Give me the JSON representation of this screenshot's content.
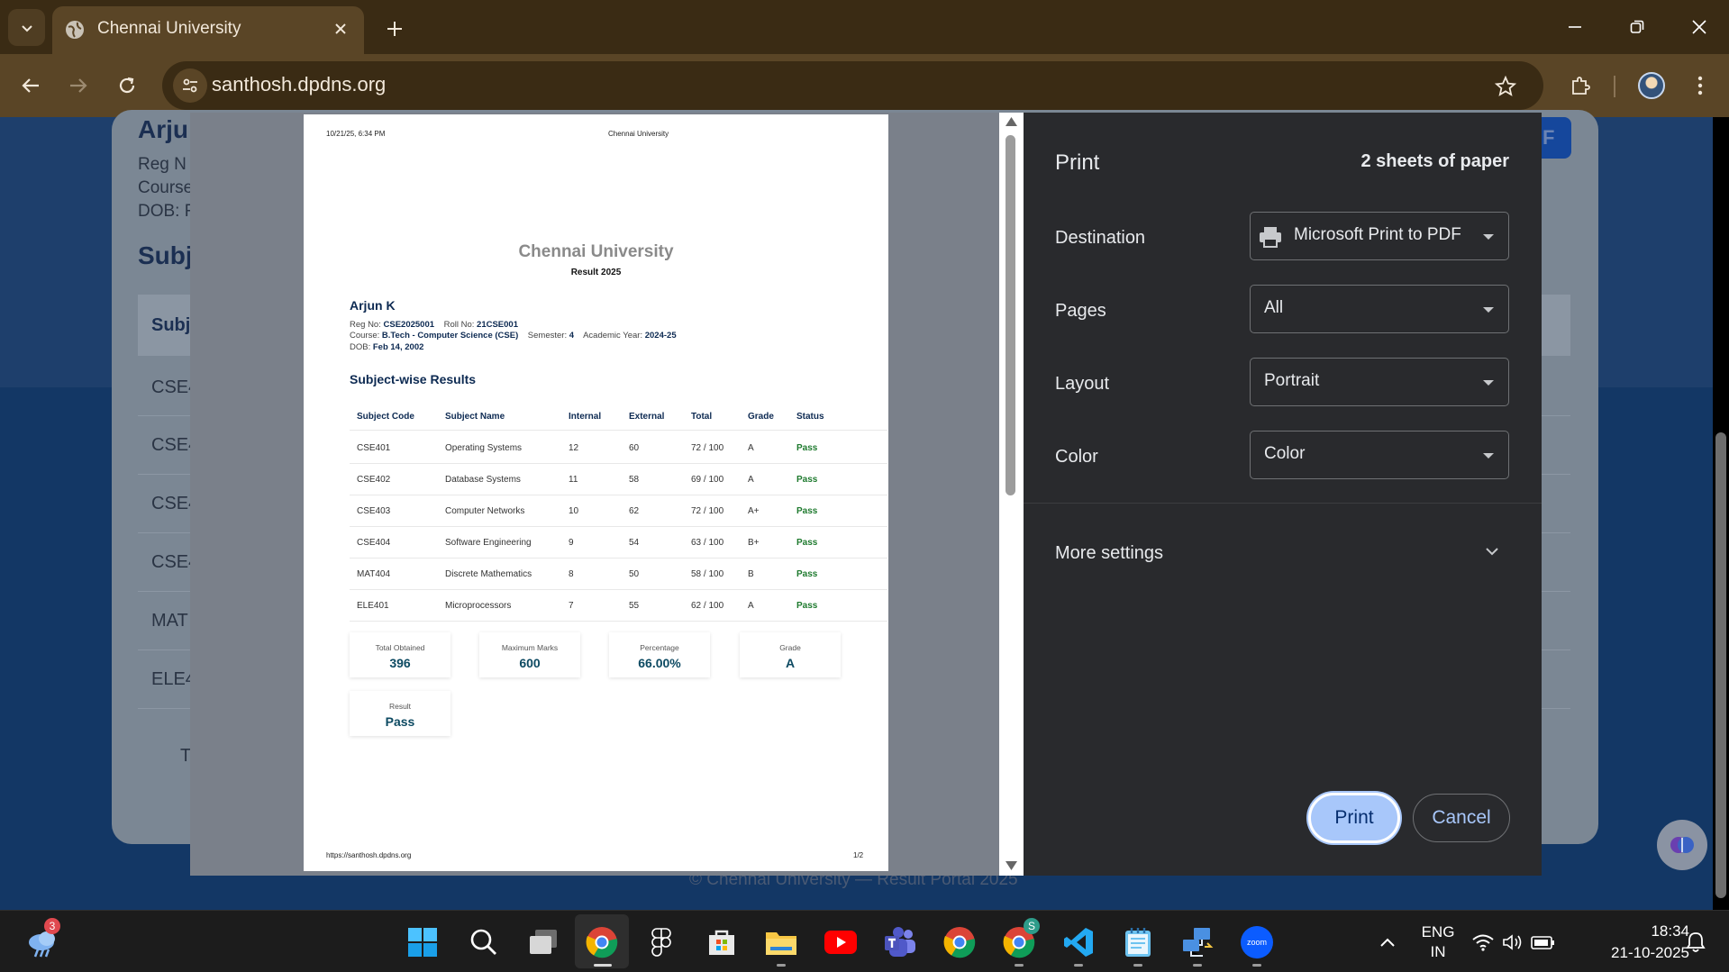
{
  "browser": {
    "tab_title": "Chennai University",
    "url": "santhosh.dpdns.org"
  },
  "background_page": {
    "student_name_partial": "Arju",
    "reg_partial": "Reg N",
    "course_partial": "Course",
    "dob_partial": "DOB: F",
    "section_partial": "Subj",
    "table_header_partial": "Subj",
    "rows_partial": [
      "CSE4",
      "CSE4",
      "CSE4",
      "CSE4",
      "MAT",
      "ELE4"
    ],
    "summary_partial": "T",
    "button_partial": "F",
    "footer": "© Chennai University — Result Portal 2025"
  },
  "preview": {
    "header_datetime": "10/21/25, 6:34 PM",
    "header_title": "Chennai University",
    "university": "Chennai University",
    "result_title": "Result 2025",
    "student_name": "Arjun K",
    "reg_label": "Reg No:",
    "reg_no": "CSE2025001",
    "roll_label": "Roll No:",
    "roll_no": "21CSE001",
    "course_label": "Course:",
    "course": "B.Tech - Computer Science (CSE)",
    "semester_label": "Semester:",
    "semester": "4",
    "year_label": "Academic Year:",
    "academic_year": "2024-25",
    "dob_label": "DOB:",
    "dob": "Feb 14, 2002",
    "section_title": "Subject-wise Results",
    "columns": [
      "Subject Code",
      "Subject Name",
      "Internal",
      "External",
      "Total",
      "Grade",
      "Status"
    ],
    "rows": [
      {
        "code": "CSE401",
        "name": "Operating Systems",
        "internal": "12",
        "external": "60",
        "total": "72 / 100",
        "grade": "A",
        "status": "Pass"
      },
      {
        "code": "CSE402",
        "name": "Database Systems",
        "internal": "11",
        "external": "58",
        "total": "69 / 100",
        "grade": "A",
        "status": "Pass"
      },
      {
        "code": "CSE403",
        "name": "Computer Networks",
        "internal": "10",
        "external": "62",
        "total": "72 / 100",
        "grade": "A+",
        "status": "Pass"
      },
      {
        "code": "CSE404",
        "name": "Software Engineering",
        "internal": "9",
        "external": "54",
        "total": "63 / 100",
        "grade": "B+",
        "status": "Pass"
      },
      {
        "code": "MAT404",
        "name": "Discrete Mathematics",
        "internal": "8",
        "external": "50",
        "total": "58 / 100",
        "grade": "B",
        "status": "Pass"
      },
      {
        "code": "ELE401",
        "name": "Microprocessors",
        "internal": "7",
        "external": "55",
        "total": "62 / 100",
        "grade": "A",
        "status": "Pass"
      }
    ],
    "summary": [
      {
        "label": "Total Obtained",
        "value": "396"
      },
      {
        "label": "Maximum Marks",
        "value": "600"
      },
      {
        "label": "Percentage",
        "value": "66.00%"
      },
      {
        "label": "Grade",
        "value": "A"
      },
      {
        "label": "Result",
        "value": "Pass"
      }
    ],
    "footer_url": "https://santhosh.dpdns.org",
    "page_number": "1/2"
  },
  "print_settings": {
    "title": "Print",
    "sheets": "2 sheets of paper",
    "destination_label": "Destination",
    "destination_value": "Microsoft Print to PDF",
    "pages_label": "Pages",
    "pages_value": "All",
    "layout_label": "Layout",
    "layout_value": "Portrait",
    "color_label": "Color",
    "color_value": "Color",
    "more_settings": "More settings",
    "print_button": "Print",
    "cancel_button": "Cancel"
  },
  "taskbar": {
    "weather_badge": "3",
    "chrome_profile_badge": "S",
    "language_line1": "ENG",
    "language_line2": "IN",
    "time": "18:34",
    "date": "21-10-2025"
  },
  "colors": {
    "print_button": "#a8c7fa",
    "dialog_bg": "#292a2d",
    "chrome_frame": "#5a4526",
    "pass_green": "#1e7a2e",
    "navy": "#0d2a52"
  }
}
